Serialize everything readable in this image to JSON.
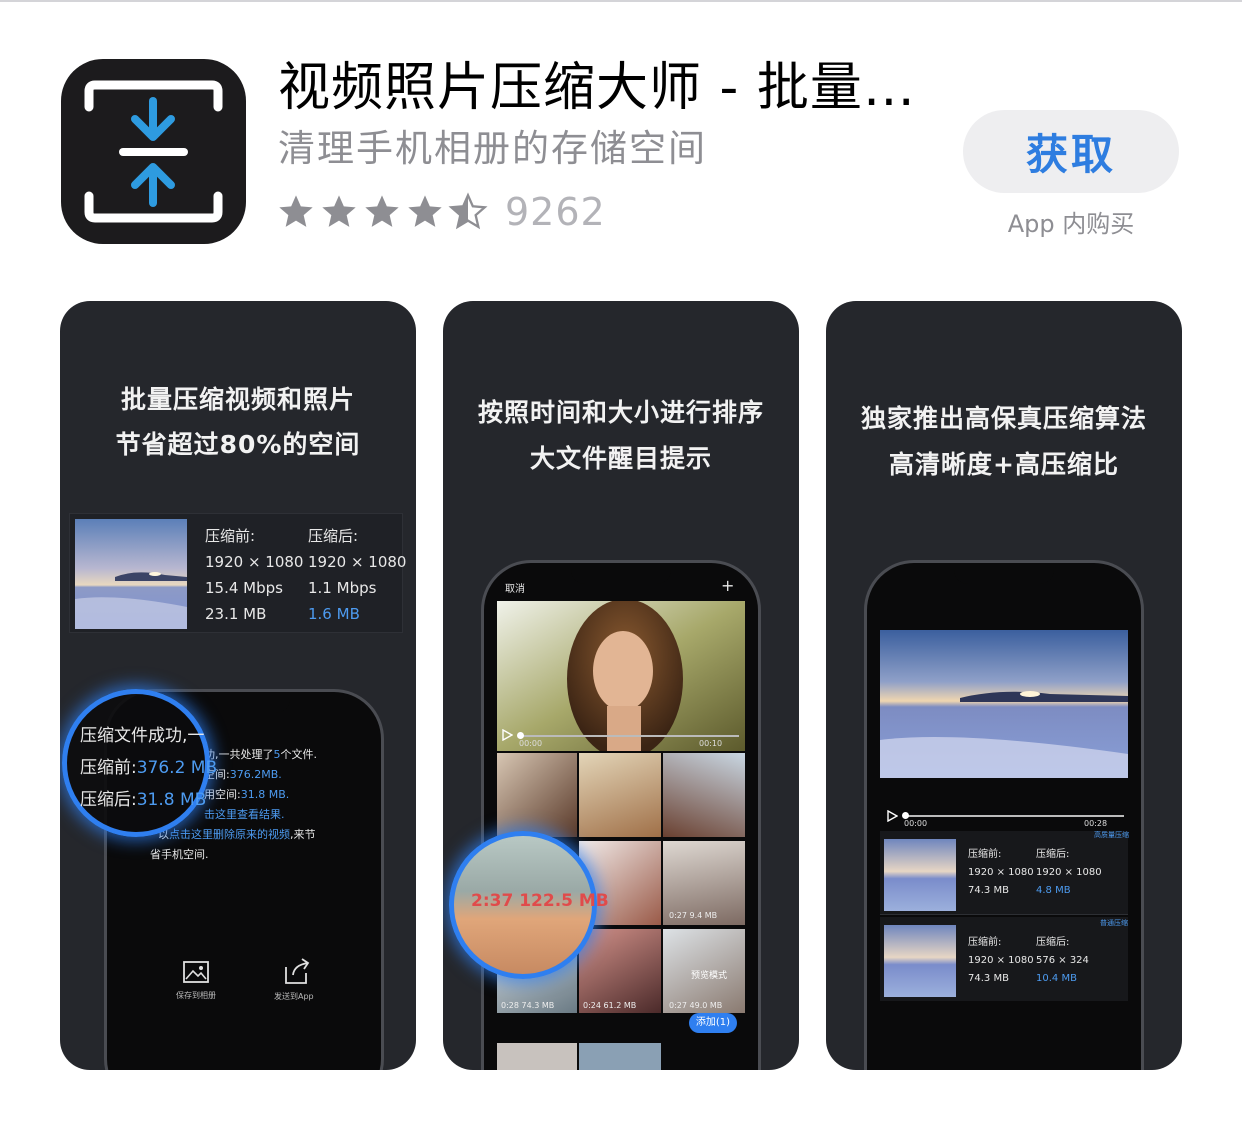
{
  "app": {
    "title": "视频照片压缩大师 - 批量…",
    "subtitle": "清理手机相册的存储空间",
    "rating": 4.5,
    "rating_count": "9262",
    "get_label": "获取",
    "iap_label": "App 内购买",
    "accent": "#2e7de0",
    "icon": "compress-arrows-icon"
  },
  "screenshots": [
    {
      "caption_line1": "批量压缩视频和照片",
      "caption_line2": "节省超过80%的空间",
      "before_label": "压缩前:",
      "after_label": "压缩后:",
      "before_res": "1920 × 1080",
      "after_res": "1920 × 1080",
      "before_bitrate": "15.4 Mbps",
      "after_bitrate": "1.1 Mbps",
      "before_size": "23.1 MB",
      "after_size": "1.6 MB",
      "lens_line1": "压缩文件成功,一",
      "lens_line2_label": "压缩前:",
      "lens_line2_value": "376.2 MB",
      "lens_line3_label": "压缩后:",
      "lens_line3_value": "31.8 MB",
      "screen_line1a": "功,一共处理了",
      "screen_line1b": "5",
      "screen_line1c": "个文件.",
      "screen_line2a": "空间:",
      "screen_line2b": "376.2MB.",
      "screen_line3a": "用空间:",
      "screen_line3b": "31.8 MB.",
      "screen_line4": "击这里查看结果.",
      "screen_line5a": "以",
      "screen_line5b": "点击这里删除原来的视频",
      "screen_line5c": ",来节",
      "screen_line6": "省手机空间.",
      "save_label": "保存到相册",
      "send_label": "发送到App"
    },
    {
      "caption_line1": "按照时间和大小进行排序",
      "caption_line2": "大文件醒目提示",
      "cancel_label": "取消",
      "plus_label": "+",
      "time_start": "00:00",
      "time_end": "00:10",
      "lens_text": "2:37 122.5 MB",
      "cell1": "0:28 74.3 MB",
      "cell2": "0:24 61.2 MB",
      "cell3": "0:27 49.0 MB",
      "cell4": "0:27 9.4 MB",
      "preview_mode": "预览模式",
      "add_label": "添加(1)"
    },
    {
      "caption_line1": "独家推出高保真压缩算法",
      "caption_line2": "高清晰度+高压缩比",
      "time_start": "00:00",
      "time_end": "00:28",
      "row1_tag": "高质量压缩",
      "row2_tag": "普通压缩",
      "before_label": "压缩前:",
      "after_label": "压缩后:",
      "row1_before_res": "1920 × 1080",
      "row1_after_res": "1920 × 1080",
      "row1_before_size": "74.3 MB",
      "row1_after_size": "4.8 MB",
      "row2_before_res": "1920 × 1080",
      "row2_after_res": "576 × 324",
      "row2_before_size": "74.3 MB",
      "row2_after_size": "10.4 MB"
    }
  ]
}
